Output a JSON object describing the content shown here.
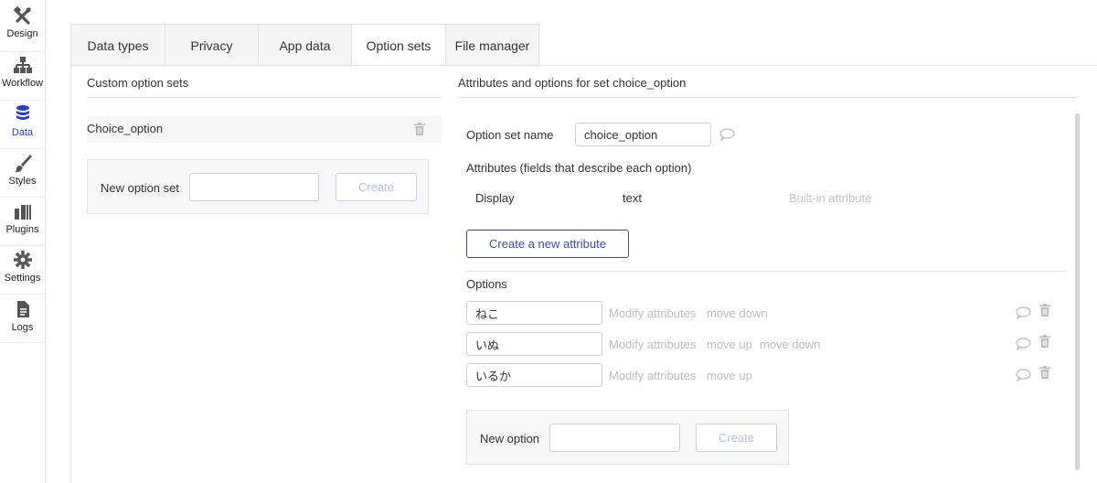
{
  "rail": {
    "items": [
      {
        "label": "Design",
        "icon": "design-tools-icon"
      },
      {
        "label": "Workflow",
        "icon": "workflow-icon"
      },
      {
        "label": "Data",
        "icon": "database-icon"
      },
      {
        "label": "Styles",
        "icon": "brush-icon"
      },
      {
        "label": "Plugins",
        "icon": "plugins-icon"
      },
      {
        "label": "Settings",
        "icon": "gear-icon"
      },
      {
        "label": "Logs",
        "icon": "document-icon"
      }
    ],
    "active": "Data",
    "accent": "#2a3fc8"
  },
  "tabs": [
    {
      "label": "Data types"
    },
    {
      "label": "Privacy"
    },
    {
      "label": "App data"
    },
    {
      "label": "Option sets"
    },
    {
      "label": "File manager"
    }
  ],
  "left": {
    "title": "Custom option sets",
    "option_sets": [
      {
        "name": "Choice_option"
      }
    ],
    "new_label": "New option set",
    "new_value": "",
    "create_label": "Create"
  },
  "right": {
    "title": "Attributes and options for set choice_option",
    "set_name_label": "Option set name",
    "set_name_value": "choice_option",
    "attributes_title": "Attributes (fields that describe each option)",
    "attributes": [
      {
        "name": "Display",
        "type": "text",
        "note": "Built-in attribute"
      }
    ],
    "create_attribute_label": "Create a new attribute",
    "options_title": "Options",
    "options": [
      {
        "value": "ねこ",
        "modify": "Modify attributes",
        "moves": [
          "move down"
        ]
      },
      {
        "value": "いぬ",
        "modify": "Modify attributes",
        "moves": [
          "move up",
          "move down"
        ]
      },
      {
        "value": "いるか",
        "modify": "Modify attributes",
        "moves": [
          "move up"
        ]
      }
    ],
    "new_option_label": "New option",
    "new_option_value": "",
    "create_label": "Create"
  }
}
